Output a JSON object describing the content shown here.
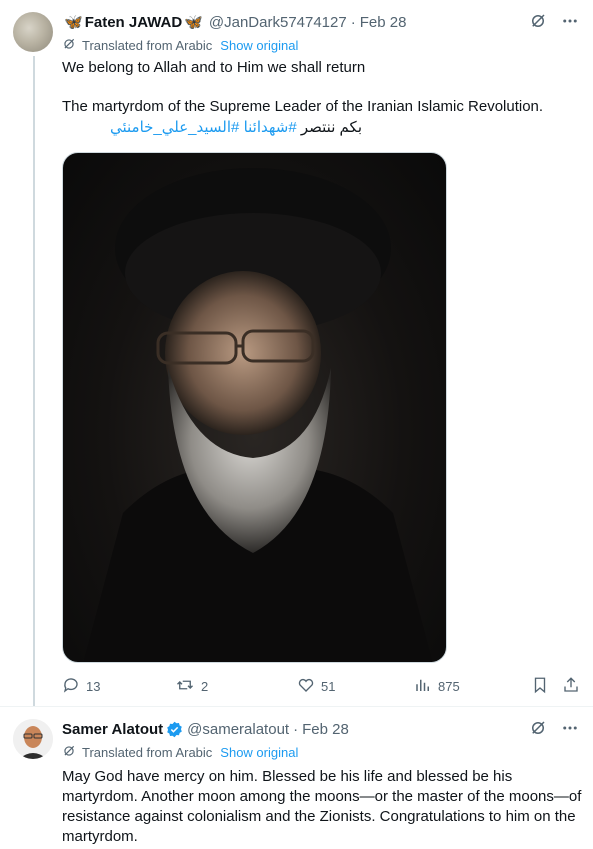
{
  "tweets": [
    {
      "author_name": "Faten JAWAD",
      "handle": "@JanDark57474127",
      "date": "Feb 28",
      "translated_label": "Translated from Arabic",
      "show_original": "Show original",
      "text_line1": "We belong to Allah and to Him we shall return",
      "text_line2": "The martyrdom of the Supreme Leader of the Iranian Islamic Revolution.",
      "rtl_plain": "بكم ننتصر",
      "hashtag1": "#شهدائنا",
      "hashtag2": "#السيد_علي_خامنئي",
      "media_description_icon": "portrait-photo",
      "stats": {
        "replies": "13",
        "reposts": "2",
        "likes": "51",
        "views": "875"
      }
    },
    {
      "author_name": "Samer Alatout",
      "handle": "@sameralatout",
      "date": "Feb 28",
      "translated_label": "Translated from Arabic",
      "show_original": "Show original",
      "text": "May God have mercy on him. Blessed be his life and blessed be his martyrdom. Another moon among the moons—or the master of the moons—of resistance against colonialism and the Zionists. Congratulations to him on the martyrdom."
    }
  ],
  "colors": {
    "accent": "#1d9bf0",
    "muted": "#536471",
    "text": "#0f1419",
    "border": "#cfd9de"
  },
  "icons": [
    "butterfly-icon",
    "verified-badge-icon",
    "grok-icon",
    "more-icon",
    "translate-icon",
    "reply-icon",
    "repost-icon",
    "like-icon",
    "views-icon",
    "bookmark-icon",
    "share-icon"
  ]
}
